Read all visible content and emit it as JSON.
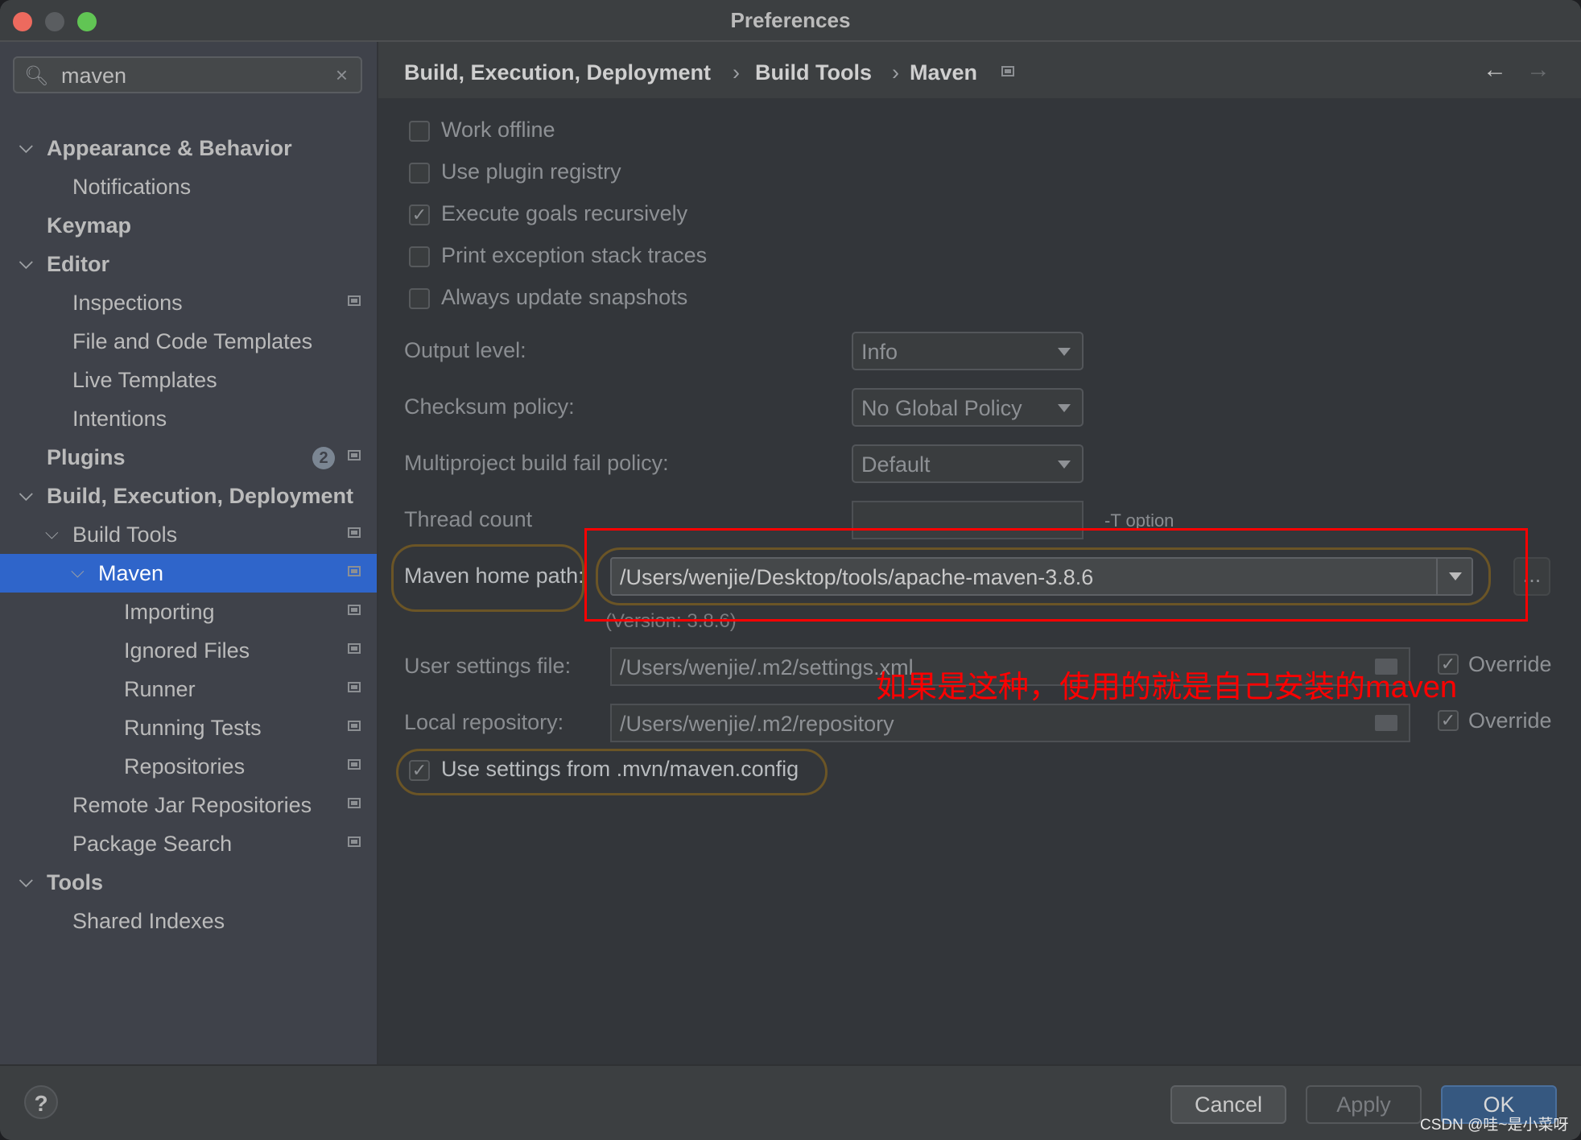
{
  "window": {
    "title": "Preferences",
    "traffic_lights": {
      "close": "#ed6a5e",
      "minimize": "#5a5d60",
      "zoom": "#61c554"
    }
  },
  "sidebar": {
    "search": {
      "icon": "search-icon",
      "value": "maven",
      "clear_icon": "close-icon"
    },
    "items": [
      {
        "label": "Appearance & Behavior",
        "level": 0,
        "bold": true,
        "expanded": true
      },
      {
        "label": "Notifications",
        "level": 1
      },
      {
        "label": "Keymap",
        "level": 0,
        "bold": true
      },
      {
        "label": "Editor",
        "level": 0,
        "bold": true,
        "expanded": true
      },
      {
        "label": "Inspections",
        "level": 1,
        "project_icon": true
      },
      {
        "label": "File and Code Templates",
        "level": 1
      },
      {
        "label": "Live Templates",
        "level": 1
      },
      {
        "label": "Intentions",
        "level": 1
      },
      {
        "label": "Plugins",
        "level": 0,
        "bold": true,
        "badge": "2",
        "project_icon": true
      },
      {
        "label": "Build, Execution, Deployment",
        "level": 0,
        "bold": true,
        "expanded": true
      },
      {
        "label": "Build Tools",
        "level": 1,
        "expanded": true,
        "project_icon": true
      },
      {
        "label": "Maven",
        "level": 2,
        "expanded": true,
        "selected": true,
        "project_icon": true
      },
      {
        "label": "Importing",
        "level": 3,
        "project_icon": true
      },
      {
        "label": "Ignored Files",
        "level": 3,
        "project_icon": true
      },
      {
        "label": "Runner",
        "level": 3,
        "project_icon": true
      },
      {
        "label": "Running Tests",
        "level": 3,
        "project_icon": true
      },
      {
        "label": "Repositories",
        "level": 3,
        "project_icon": true
      },
      {
        "label": "Remote Jar Repositories",
        "level": 1,
        "project_icon": true
      },
      {
        "label": "Package Search",
        "level": 1,
        "project_icon": true
      },
      {
        "label": "Tools",
        "level": 0,
        "bold": true,
        "expanded": true
      },
      {
        "label": "Shared Indexes",
        "level": 1
      }
    ]
  },
  "breadcrumb": {
    "items": [
      "Build, Execution, Deployment",
      "Build Tools",
      "Maven"
    ],
    "separator": "›",
    "back_icon": "arrow-left-icon",
    "forward_icon": "arrow-right-icon"
  },
  "settings": {
    "checkboxes": [
      {
        "label": "Work offline",
        "checked": false
      },
      {
        "label": "Use plugin registry",
        "checked": false
      },
      {
        "label": "Execute goals recursively",
        "checked": true
      },
      {
        "label": "Print exception stack traces",
        "checked": false
      },
      {
        "label": "Always update snapshots",
        "checked": false
      }
    ],
    "output_level": {
      "label": "Output level:",
      "value": "Info"
    },
    "checksum_policy": {
      "label": "Checksum policy:",
      "value": "No Global Policy"
    },
    "multiproject_fail_policy": {
      "label": "Multiproject build fail policy:",
      "value": "Default"
    },
    "thread_count": {
      "label": "Thread count",
      "value": "",
      "hint": "-T option"
    },
    "maven_home": {
      "label": "Maven home path:",
      "value": "/Users/wenjie/Desktop/tools/apache-maven-3.8.6",
      "browse": "...",
      "version": "(Version: 3.8.6)"
    },
    "user_settings": {
      "label": "User settings file:",
      "value": "/Users/wenjie/.m2/settings.xml",
      "override_label": "Override",
      "override": true
    },
    "local_repository": {
      "label": "Local repository:",
      "value": "/Users/wenjie/.m2/repository",
      "override_label": "Override",
      "override": true
    },
    "use_mvn_config": {
      "label": "Use settings from .mvn/maven.config",
      "checked": true
    }
  },
  "annotation": {
    "text": "如果是这种，使用的就是自己安装的maven",
    "color": "#ff0000"
  },
  "footer": {
    "help": "?",
    "cancel": "Cancel",
    "apply": "Apply",
    "ok": "OK"
  },
  "watermark": "CSDN @哇~是小菜呀"
}
